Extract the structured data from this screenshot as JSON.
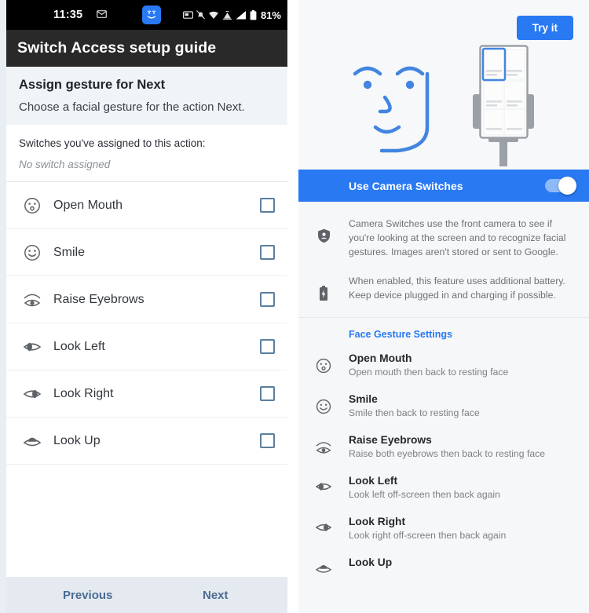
{
  "left": {
    "statusbar": {
      "time": "11:35",
      "battery_percent": "81%",
      "icons": [
        "mail-icon",
        "camera-switches-face-icon",
        "screenshot-icon",
        "notifications-muted-icon",
        "wifi-icon",
        "mobile-data-icon",
        "signal-icon",
        "battery-icon"
      ]
    },
    "appbar": {
      "title": "Switch Access setup guide"
    },
    "instruction": {
      "heading": "Assign gesture for Next",
      "body": "Choose a facial gesture for the action Next."
    },
    "assigned": {
      "label": "Switches you've assigned to this action:",
      "value": "No switch assigned"
    },
    "gestures": [
      {
        "icon": "open-mouth-icon",
        "label": "Open Mouth",
        "checked": false
      },
      {
        "icon": "smile-icon",
        "label": "Smile",
        "checked": false
      },
      {
        "icon": "raise-eyebrows-icon",
        "label": "Raise Eyebrows",
        "checked": false
      },
      {
        "icon": "look-left-icon",
        "label": "Look Left",
        "checked": false
      },
      {
        "icon": "look-right-icon",
        "label": "Look Right",
        "checked": false
      },
      {
        "icon": "look-up-icon",
        "label": "Look Up",
        "checked": false
      }
    ],
    "footer": {
      "previous": "Previous",
      "next": "Next"
    }
  },
  "right": {
    "hero": {
      "try_button": "Try it",
      "illustration": "face-and-phone-on-stand-illustration"
    },
    "camera_switches": {
      "label": "Use Camera Switches",
      "enabled": true
    },
    "info": [
      {
        "icon": "privacy-shield-icon",
        "text": "Camera Switches use the front camera to see if you're looking at the screen and to recognize facial gestures. Images aren't stored or sent to Google."
      },
      {
        "icon": "battery-charging-icon",
        "text": "When enabled, this feature uses additional battery. Keep device plugged in and charging if possible."
      }
    ],
    "face_gesture_settings": {
      "title": "Face Gesture Settings",
      "items": [
        {
          "icon": "open-mouth-icon",
          "title": "Open Mouth",
          "desc": "Open mouth then back to resting face"
        },
        {
          "icon": "smile-icon",
          "title": "Smile",
          "desc": "Smile then back to resting face"
        },
        {
          "icon": "raise-eyebrows-icon",
          "title": "Raise Eyebrows",
          "desc": "Raise both eyebrows then back to resting face"
        },
        {
          "icon": "look-left-icon",
          "title": "Look Left",
          "desc": "Look left off-screen then back again"
        },
        {
          "icon": "look-right-icon",
          "title": "Look Right",
          "desc": "Look right off-screen then back again"
        },
        {
          "icon": "look-up-icon",
          "title": "Look Up",
          "desc": ""
        }
      ]
    }
  },
  "colors": {
    "accent_blue": "#2979f2",
    "appbar_dark": "#292929",
    "checkbox_border": "#5b7f9e",
    "footer_link": "#4a6b94"
  }
}
